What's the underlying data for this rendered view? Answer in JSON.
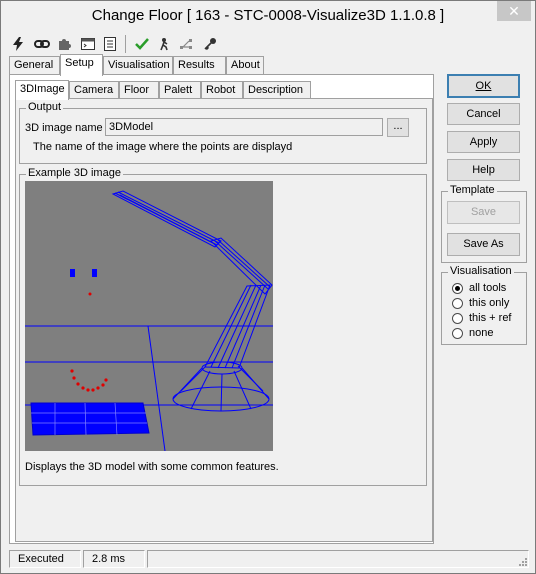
{
  "window": {
    "title": "Change Floor [ 163 - STC-0008-Visualize3D 1.1.0.8 ]",
    "close_label": "✕"
  },
  "toolbar": {
    "icons": [
      "lightning-icon",
      "link-icon",
      "puzzle-icon",
      "console-icon",
      "document-list-icon",
      "checkmark-icon",
      "run-icon",
      "network-icon",
      "key-icon"
    ]
  },
  "tabs_top": [
    "General",
    "Setup",
    "Visualisation",
    "Results",
    "About"
  ],
  "tabs_inner": [
    "3DImage",
    "Camera",
    "Floor",
    "Palett",
    "Robot",
    "Description"
  ],
  "output": {
    "legend": "Output",
    "image_name_label": "3D image name",
    "image_name_value": "3DModel",
    "browse_label": "...",
    "description": "The name of the image where the points are displayd"
  },
  "example": {
    "legend": "Example 3D image",
    "caption": "Displays the 3D model with some common features."
  },
  "buttons": {
    "ok": "OK",
    "cancel": "Cancel",
    "apply": "Apply",
    "help": "Help"
  },
  "template": {
    "legend": "Template",
    "save": "Save",
    "save_as": "Save As"
  },
  "visualisation": {
    "legend": "Visualisation",
    "options": [
      "all tools",
      "this only",
      "this + ref",
      "none"
    ],
    "selected": "all tools"
  },
  "status": {
    "state": "Executed",
    "time": "2.8 ms"
  },
  "colors": {
    "model_blue": "#0000ff",
    "points_red": "#e00000",
    "viewport_bg": "#7f7f7f"
  }
}
